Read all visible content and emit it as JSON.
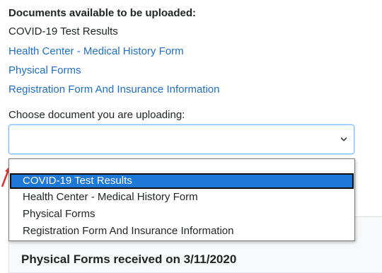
{
  "documents": {
    "heading": "Documents available to be uploaded:",
    "items": [
      {
        "label": "COVID-19 Test Results",
        "is_link": false
      },
      {
        "label": "Health Center - Medical History Form",
        "is_link": true
      },
      {
        "label": "Physical Forms",
        "is_link": true
      },
      {
        "label": "Registration Form And Insurance Information",
        "is_link": true
      }
    ]
  },
  "upload": {
    "label": "Choose document you are uploading:",
    "selected_value": "",
    "options": [
      {
        "label": ""
      },
      {
        "label": "COVID-19 Test Results",
        "highlighted": true
      },
      {
        "label": "Health Center - Medical History Form"
      },
      {
        "label": "Physical Forms"
      },
      {
        "label": "Registration Form And Insurance Information"
      }
    ]
  },
  "background": {
    "partial_heading": "Physical Forms received on 3/11/2020"
  },
  "colors": {
    "link": "#1f6fc8",
    "highlight": "#1e78d7",
    "focus_border": "#80bdff",
    "annotation_arrow": "#e03030"
  }
}
